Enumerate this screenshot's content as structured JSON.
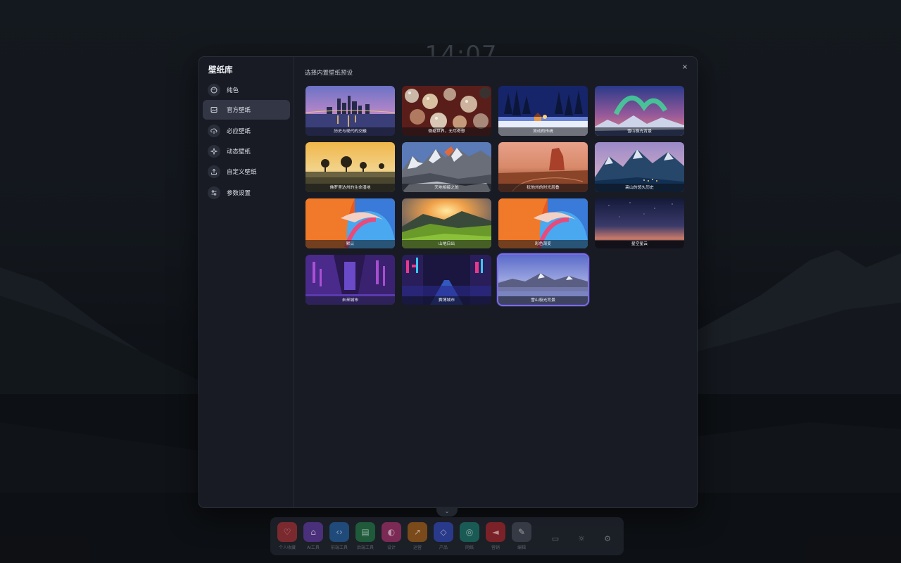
{
  "clock": "14:07",
  "modal": {
    "title": "壁纸库",
    "close_label": "×",
    "content_title": "选择内置壁纸预设",
    "sidebar": [
      {
        "label": "纯色",
        "icon": "palette-icon"
      },
      {
        "label": "官方壁纸",
        "icon": "image-icon",
        "active": true
      },
      {
        "label": "必应壁纸",
        "icon": "cloud-download-icon"
      },
      {
        "label": "动态壁纸",
        "icon": "sparkle-icon"
      },
      {
        "label": "自定义壁纸",
        "icon": "upload-icon"
      },
      {
        "label": "参数设置",
        "icon": "sliders-icon"
      }
    ],
    "wallpapers": [
      {
        "caption": "历史与现代的交融"
      },
      {
        "caption": "微缩世界，无尽奇想"
      },
      {
        "caption": "流动的传统"
      },
      {
        "caption": "雪山极光背景"
      },
      {
        "caption": "佛罗里达州的生命湿地"
      },
      {
        "caption": "天地相接之处"
      },
      {
        "caption": "犹他州的时光层叠"
      },
      {
        "caption": "高山的悠久历史"
      },
      {
        "caption": "默认"
      },
      {
        "caption": "山地日出"
      },
      {
        "caption": "彩色渐变"
      },
      {
        "caption": "星空星云"
      },
      {
        "caption": "未来城市"
      },
      {
        "caption": "赛博城市"
      },
      {
        "caption": "雪山极光背景",
        "selected": true
      }
    ]
  },
  "dock": {
    "items": [
      {
        "label": "个人收藏",
        "color": "#7a2a2f",
        "icon": "heart-icon"
      },
      {
        "label": "AI工具",
        "color": "#4a2f7a",
        "icon": "robot-icon"
      },
      {
        "label": "前端工具",
        "color": "#1f4a7a",
        "icon": "code-icon"
      },
      {
        "label": "后端工具",
        "color": "#1f5a3a",
        "icon": "server-icon"
      },
      {
        "label": "设计",
        "color": "#7a2a55",
        "icon": "palette-icon"
      },
      {
        "label": "运营",
        "color": "#7a4a1a",
        "icon": "trend-icon"
      },
      {
        "label": "产品",
        "color": "#2a3a8a",
        "icon": "cube-icon"
      },
      {
        "label": "网络",
        "color": "#1a5a55",
        "icon": "globe-icon"
      },
      {
        "label": "营销",
        "color": "#7a2228",
        "icon": "megaphone-icon"
      },
      {
        "label": "编辑",
        "color": "#353a44",
        "icon": "edit-icon"
      }
    ],
    "utilities": [
      "folder-icon",
      "sun-icon",
      "settings-icon"
    ]
  }
}
